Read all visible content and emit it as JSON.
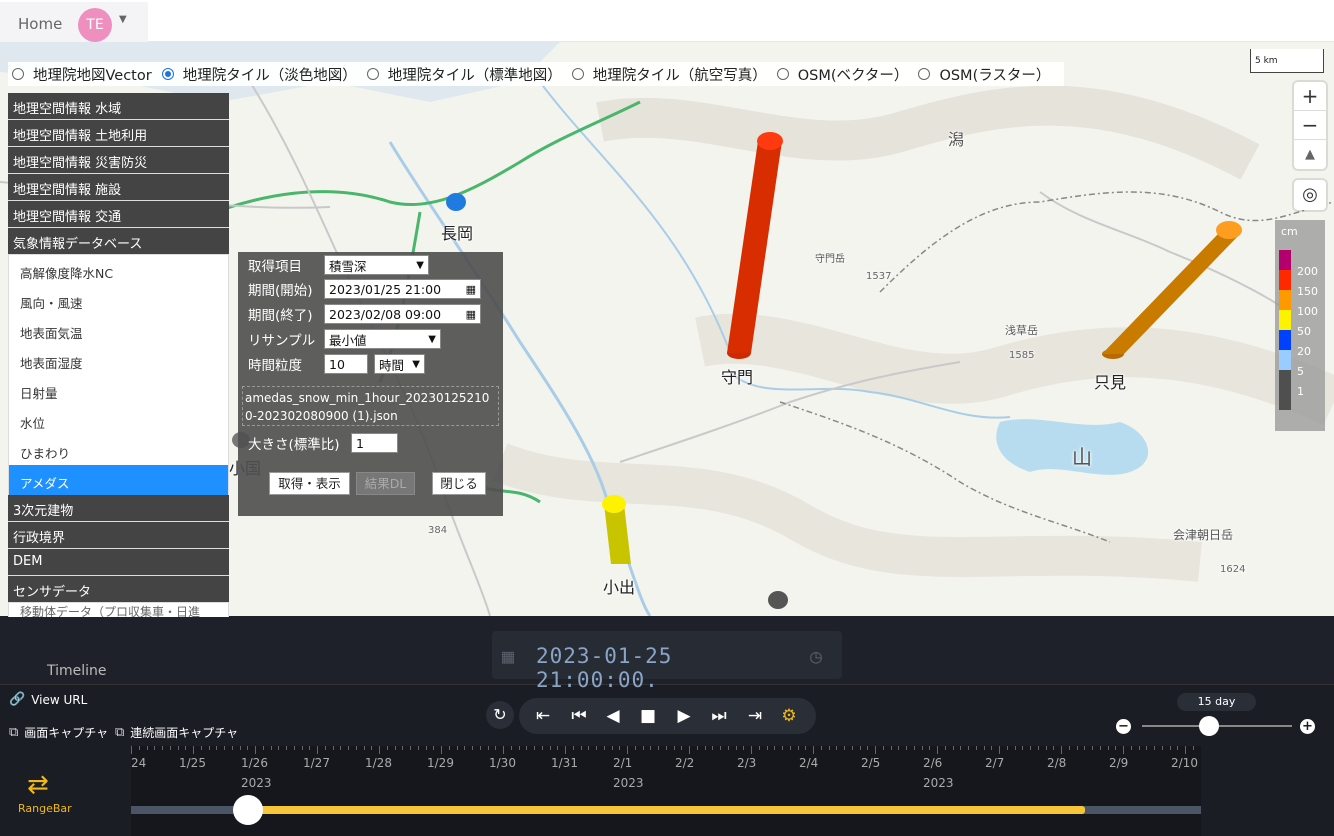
{
  "nav": {
    "home": "Home",
    "avatar": "TE"
  },
  "base_layers": [
    {
      "label": "地理院地図Vector",
      "selected": false
    },
    {
      "label": "地理院タイル（淡色地図）",
      "selected": true
    },
    {
      "label": "地理院タイル（標準地図）",
      "selected": false
    },
    {
      "label": "地理院タイル（航空写真）",
      "selected": false
    },
    {
      "label": "OSM(ベクター）",
      "selected": false
    },
    {
      "label": "OSM(ラスター）",
      "selected": false
    }
  ],
  "scale": "5 km",
  "map_controls": {
    "zoom_in": "+",
    "zoom_out": "−",
    "compass": "▲",
    "locate": "◎"
  },
  "menu": {
    "groups_top": [
      "地理空間情報 水域",
      "地理空間情報 土地利用",
      "地理空間情報 災害防災",
      "地理空間情報 施設",
      "地理空間情報 交通",
      "気象情報データベース"
    ],
    "sub_items": [
      "高解像度降水NC",
      "風向・風速",
      "地表面気温",
      "地表面湿度",
      "日射量",
      "水位",
      "ひまわり",
      "アメダス"
    ],
    "active_sub": "アメダス",
    "groups_bottom": [
      "3次元建物",
      "行政境界",
      "DEM",
      "センサデータ"
    ],
    "cut_item": "移動体データ（プロ収集車・日進市）"
  },
  "panel": {
    "item_label": "取得項目",
    "item_value": "積雪深",
    "start_label": "期間(開始)",
    "start_value": "2023/01/25 21:00",
    "end_label": "期間(終了)",
    "end_value": "2023/02/08 09:00",
    "resample_label": "リサンプル",
    "resample_value": "最小値",
    "granularity_label": "時間粒度",
    "granularity_value": "10",
    "granularity_unit": "時間",
    "filename": "amedas_snow_min_1hour_202301252100-202302080900 (1).json",
    "size_label": "大きさ(標準比)",
    "size_value": "1",
    "btn_fetch": "取得・表示",
    "btn_download": "結果DL",
    "btn_close": "閉じる"
  },
  "legend": {
    "unit": "cm",
    "levels": [
      {
        "value": "200",
        "color": "#b4006c"
      },
      {
        "value": "150",
        "color": "#ff2800"
      },
      {
        "value": "100",
        "color": "#ff9900"
      },
      {
        "value": "50",
        "color": "#fff200"
      },
      {
        "value": "20",
        "color": "#0041ff"
      },
      {
        "value": "5",
        "color": "#99ccff"
      },
      {
        "value": "1",
        "color": "#4f4f4f"
      }
    ]
  },
  "places": {
    "nagaoka": "長岡",
    "sumon": "守門",
    "tadami": "只見",
    "koide": "小出",
    "oguni_partial": "小国",
    "kanji_gata": "潟",
    "kanji_yama": "山",
    "aizu": "会津朝日岳",
    "elev_1585": "1585",
    "elev_1624": "1624",
    "elev_1537": "1537",
    "elev_384": "384",
    "asakusa": "浅草岳",
    "sumondake": "守門岳"
  },
  "timeline": {
    "title": "Timeline",
    "clock": "2023-01-25 21:00:00.",
    "view_url": "View URL",
    "capture": "画面キャプチャ",
    "continuous_capture": "連続画面キャプチャ",
    "zoom_label": "15 day",
    "rangebar": "RangeBar",
    "ticks": [
      "24",
      "1/25",
      "1/26",
      "1/27",
      "1/28",
      "1/29",
      "1/30",
      "1/31",
      "2/1",
      "2/2",
      "2/3",
      "2/4",
      "2/5",
      "2/6",
      "2/7",
      "2/8",
      "2/9",
      "2/10"
    ],
    "years": [
      "2023",
      "2023",
      "2023"
    ],
    "progress_fraction": 0.82,
    "current_fraction": 0.108
  }
}
